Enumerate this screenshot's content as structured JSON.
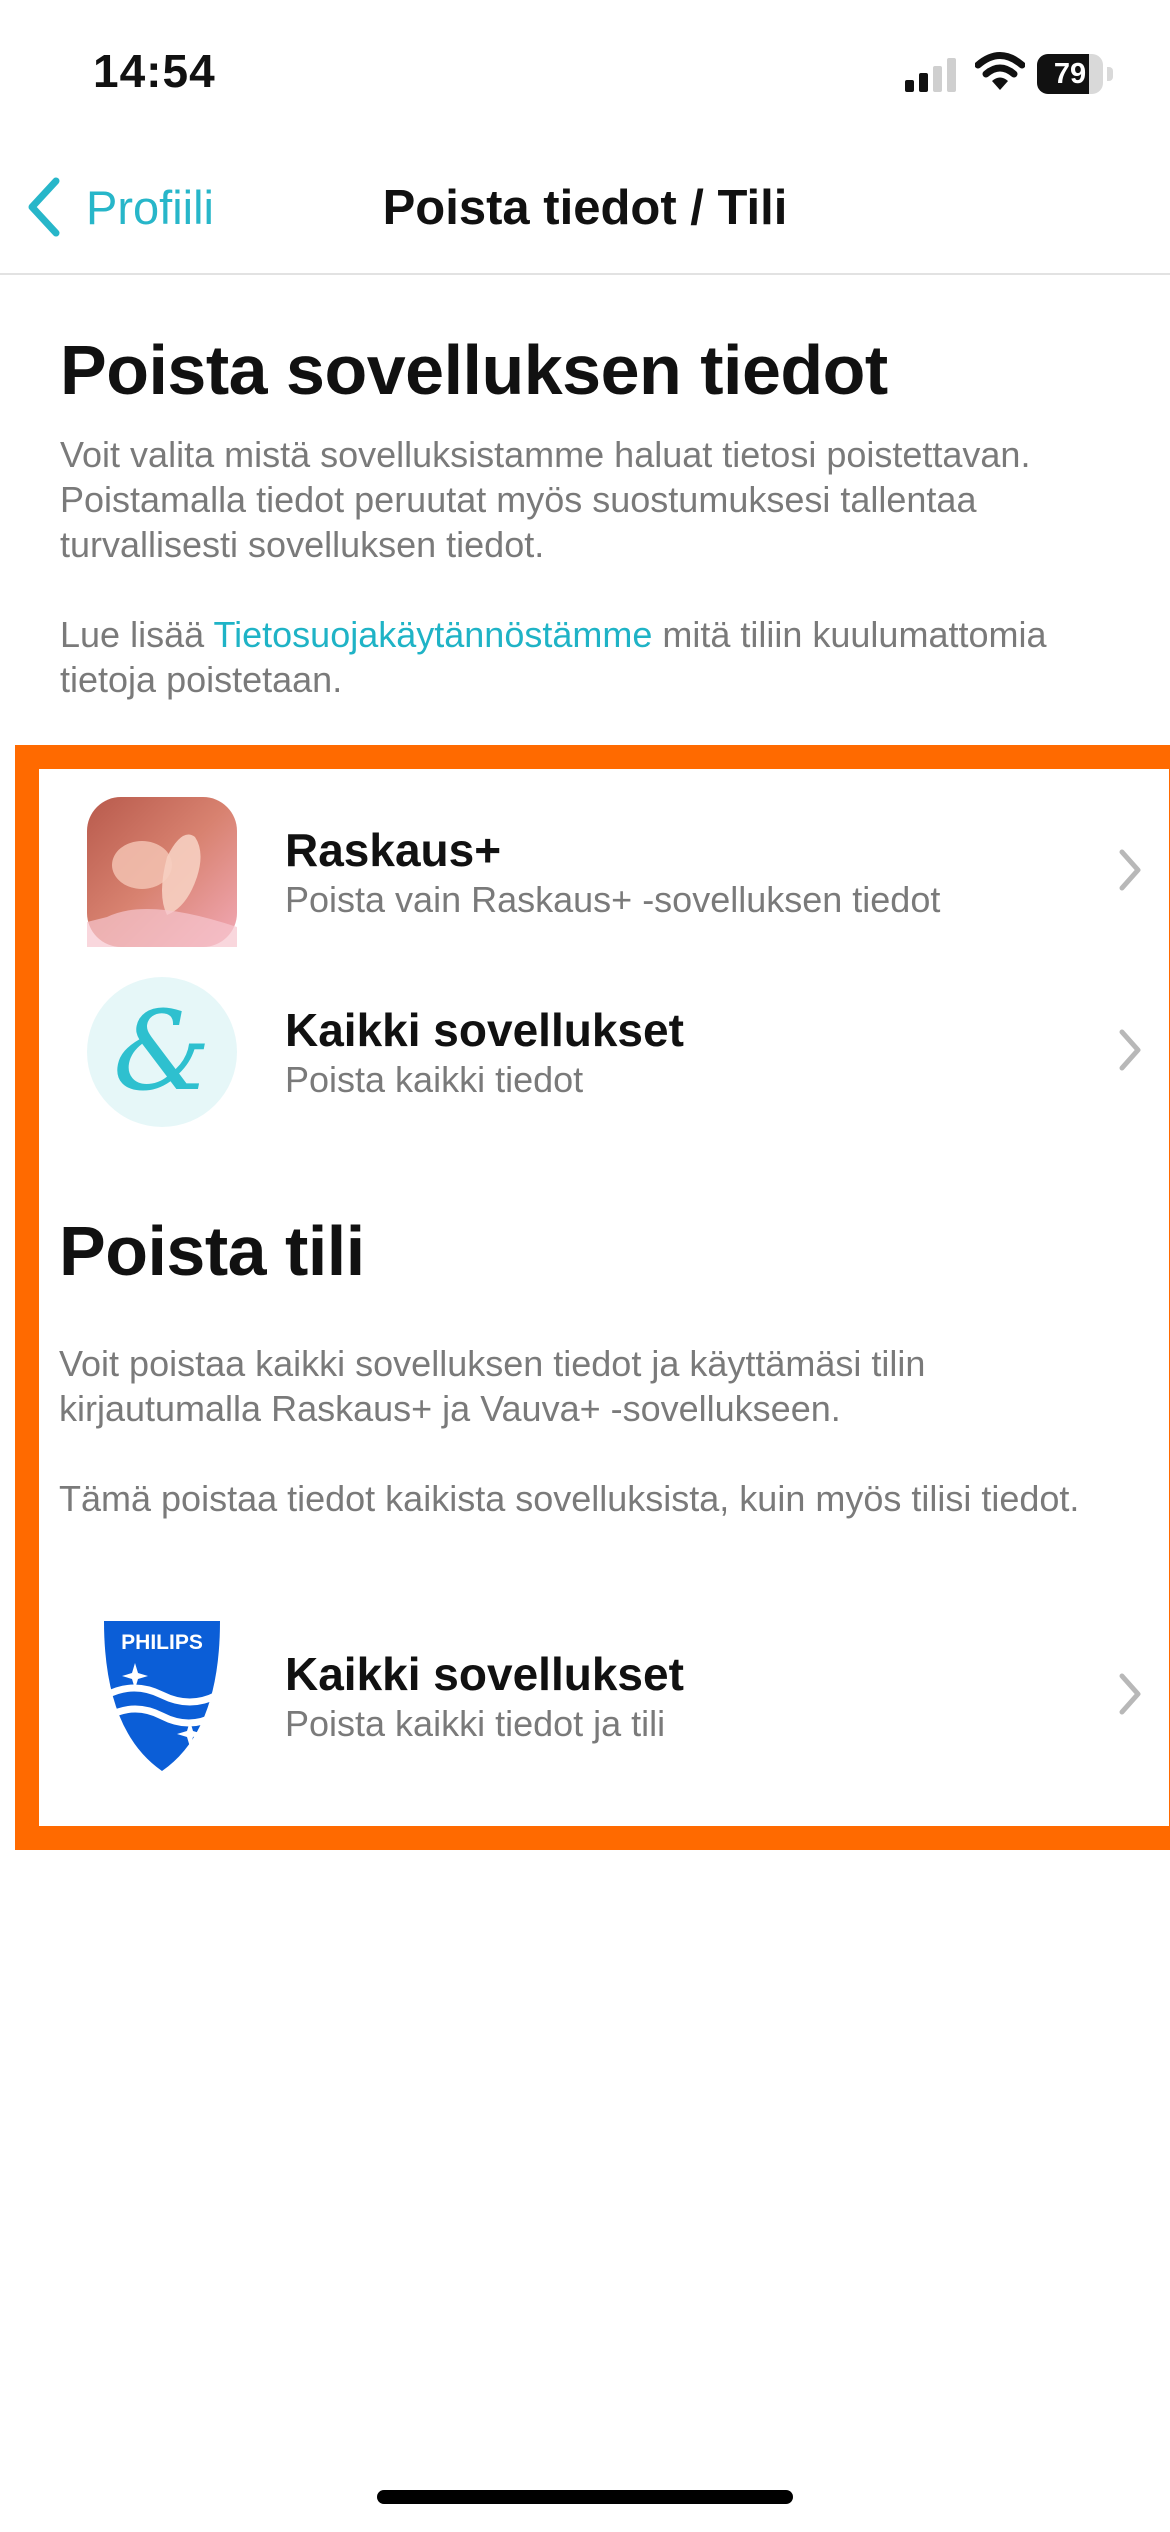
{
  "status_bar": {
    "time": "14:54",
    "battery_percent": "79",
    "signal_bars_filled": 2,
    "signal_bars_total": 4
  },
  "nav": {
    "back_label": "Profiili",
    "title": "Poista tiedot / Tili"
  },
  "delete_data_section": {
    "title": "Poista sovelluksen tiedot",
    "description": "Voit valita mistä sovelluksistamme haluat tietosi poistettavan. Poistamalla tiedot peruutat myös suostumuksesi tallentaa turvallisesti sovelluksen tiedot.",
    "read_more_prefix": "Lue lisää ",
    "read_more_link": "Tietosuojakäytännöstämme",
    "read_more_suffix": " mitä tiliin kuulumattomia tietoja poistetaan."
  },
  "app_rows": [
    {
      "title": "Raskaus+",
      "subtitle": "Poista vain Raskaus+ -sovelluksen tiedot",
      "icon": "raskaus-app-icon"
    },
    {
      "title": "Kaikki sovellukset",
      "subtitle": "Poista kaikki tiedot",
      "icon": "ampersand-app-icon"
    }
  ],
  "delete_account_section": {
    "title": "Poista tili",
    "description1": "Voit poistaa kaikki sovelluksen tiedot ja käyttämäsi tilin kirjautumalla Raskaus+ ja Vauva+ -sovellukseen.",
    "description2": "Tämä poistaa tiedot kaikista sovelluksista, kuin myös tilisi tiedot."
  },
  "account_row": {
    "title": "Kaikki sovellukset",
    "subtitle": "Poista kaikki tiedot ja tili",
    "logo_text": "PHILIPS",
    "icon": "philips-shield-logo"
  },
  "colors": {
    "accent": "#27b6c9",
    "highlight": "#ff6a00",
    "philips_blue": "#0b5ed7"
  }
}
